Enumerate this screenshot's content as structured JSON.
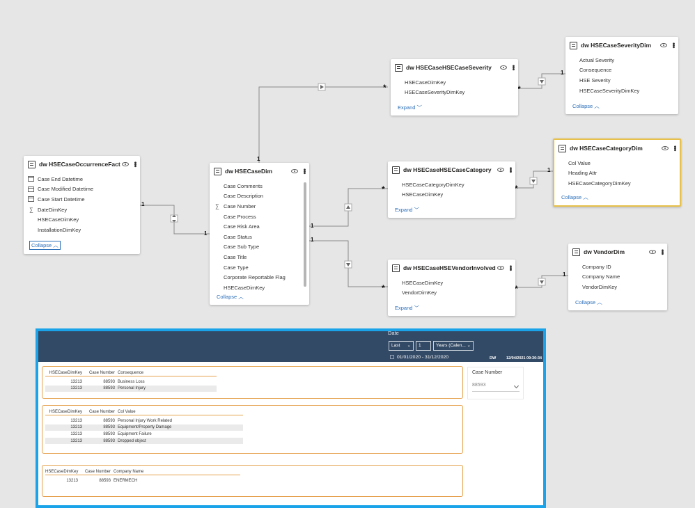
{
  "model": {
    "occurrence": {
      "title": "dw HSECaseOccurrenceFact",
      "fields": [
        "Case End Datetime",
        "Case Modified Datetime",
        "Case Start Datetime",
        "DateDimKey",
        "HSECaseDimKey",
        "InstallationDimKey"
      ],
      "footer": "Collapse"
    },
    "casedim": {
      "title": "dw HSECaseDim",
      "fields": [
        "Case Comments",
        "Case Description",
        "Case Number",
        "Case Process",
        "Case Risk Area",
        "Case Status",
        "Case Sub Type",
        "Case Title",
        "Case Type",
        "Corporate Reportable Flag",
        "HSECaseDimKey"
      ],
      "footer": "Collapse"
    },
    "severity_bridge": {
      "title": "dw HSECaseHSECaseSeverity",
      "fields": [
        "HSECaseDimKey",
        "HSECaseSeverityDimKey"
      ],
      "footer": "Expand"
    },
    "severity_dim": {
      "title": "dw HSECaseSeverityDim",
      "fields": [
        "Actual Severity",
        "Consequence",
        "HSE Severity",
        "HSECaseSeverityDimKey"
      ],
      "footer": "Collapse"
    },
    "category_bridge": {
      "title": "dw HSECaseHSECaseCategory",
      "fields": [
        "HSECaseCategoryDimKey",
        "HSECaseDimKey"
      ],
      "footer": "Expand"
    },
    "category_dim": {
      "title": "dw HSECaseCategoryDim",
      "fields": [
        "Col Value",
        "Heading Attr",
        "HSECaseCategoryDimKey"
      ],
      "footer": "Collapse"
    },
    "vendor_bridge": {
      "title": "dw HSECaseHSEVendorInvolved",
      "fields": [
        "HSECaseDimKey",
        "VendorDimKey"
      ],
      "footer": "Expand"
    },
    "vendor_dim": {
      "title": "dw VendorDim",
      "fields": [
        "Company ID",
        "Company Name",
        "VendorDimKey"
      ],
      "footer": "Collapse"
    }
  },
  "cardinality": {
    "one": "1",
    "many": "*"
  },
  "report": {
    "date_label": "Date",
    "period_type": "Last",
    "period_count": "1",
    "period_unit": "Years (Calen...",
    "date_range": "01/01/2020 - 31/12/2020",
    "dw_label": "DW",
    "timestamp": "12/04/2021 09:30:34",
    "slicer": {
      "title": "Case Number",
      "value": "88593"
    },
    "table1": {
      "headers": [
        "HSECaseDimKey",
        "Case Number",
        "Consequence"
      ],
      "rows": [
        [
          "13213",
          "88593",
          "Business Loss"
        ],
        [
          "13213",
          "88593",
          "Personal Injury"
        ]
      ]
    },
    "table2": {
      "headers": [
        "HSECaseDimKey",
        "Case Number",
        "Col Value"
      ],
      "rows": [
        [
          "13213",
          "88593",
          "Personal Injury Work Related"
        ],
        [
          "13213",
          "88593",
          "Equipment/Property Damage"
        ],
        [
          "13213",
          "88593",
          "Equipment Failure"
        ],
        [
          "13213",
          "88593",
          "Dropped object"
        ]
      ]
    },
    "table3": {
      "headers": [
        "HSECaseDimKey",
        "Case Number",
        "Company Name"
      ],
      "rows": [
        [
          "13213",
          "88593",
          "ENERMECH"
        ]
      ]
    }
  }
}
